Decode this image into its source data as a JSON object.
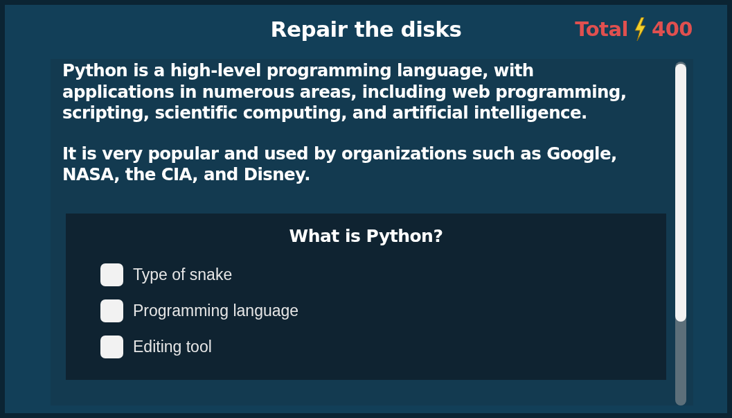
{
  "header": {
    "title": "Repair the disks",
    "total_label": "Total",
    "total_value": "400"
  },
  "paragraphs": [
    "Python is a high-level programming language, with applications in numerous areas, including web programming, scripting, scientific computing, and artificial intelligence.",
    "It is very popular and used by organizations such as Google, NASA, the CIA, and Disney."
  ],
  "quiz": {
    "question": "What is Python?",
    "options": [
      {
        "label": "Type of snake",
        "checked": false
      },
      {
        "label": "Programming language",
        "checked": false
      },
      {
        "label": "Editing tool",
        "checked": false
      }
    ]
  }
}
